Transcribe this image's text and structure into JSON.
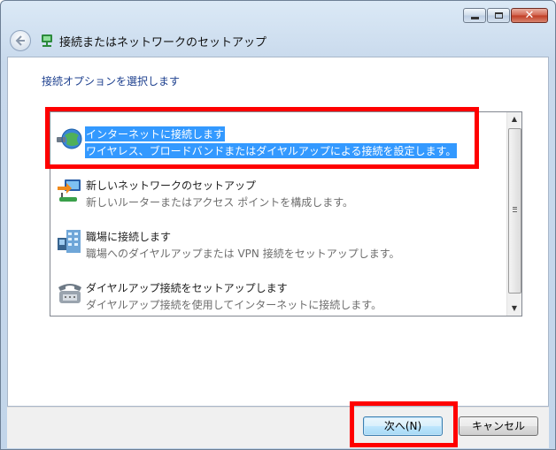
{
  "window": {
    "title": "接続またはネットワークのセットアップ",
    "controls": {
      "minimize": "minimize-icon",
      "maximize": "maximize-icon",
      "close": "close-icon"
    }
  },
  "main": {
    "instruction": "接続オプションを選択します",
    "options": [
      {
        "title": "インターネットに接続します",
        "description": "ワイヤレス、ブロードバンドまたはダイヤルアップによる接続を設定します。",
        "icon": "globe-network-icon",
        "selected": true
      },
      {
        "title": "新しいネットワークのセットアップ",
        "description": "新しいルーターまたはアクセス ポイントを構成します。",
        "icon": "router-setup-icon",
        "selected": false
      },
      {
        "title": "職場に接続します",
        "description": "職場へのダイヤルアップまたは VPN 接続をセットアップします。",
        "icon": "workplace-building-icon",
        "selected": false
      },
      {
        "title": "ダイヤルアップ接続をセットアップします",
        "description": "ダイヤルアップ接続を使用してインターネットに接続します。",
        "icon": "telephone-modem-icon",
        "selected": false
      }
    ]
  },
  "footer": {
    "next_label": "次へ(N)",
    "cancel_label": "キャンセル"
  },
  "colors": {
    "selection": "#3399ff",
    "highlight_annotation": "#ff0000",
    "instruction_text": "#1c3f8e"
  }
}
